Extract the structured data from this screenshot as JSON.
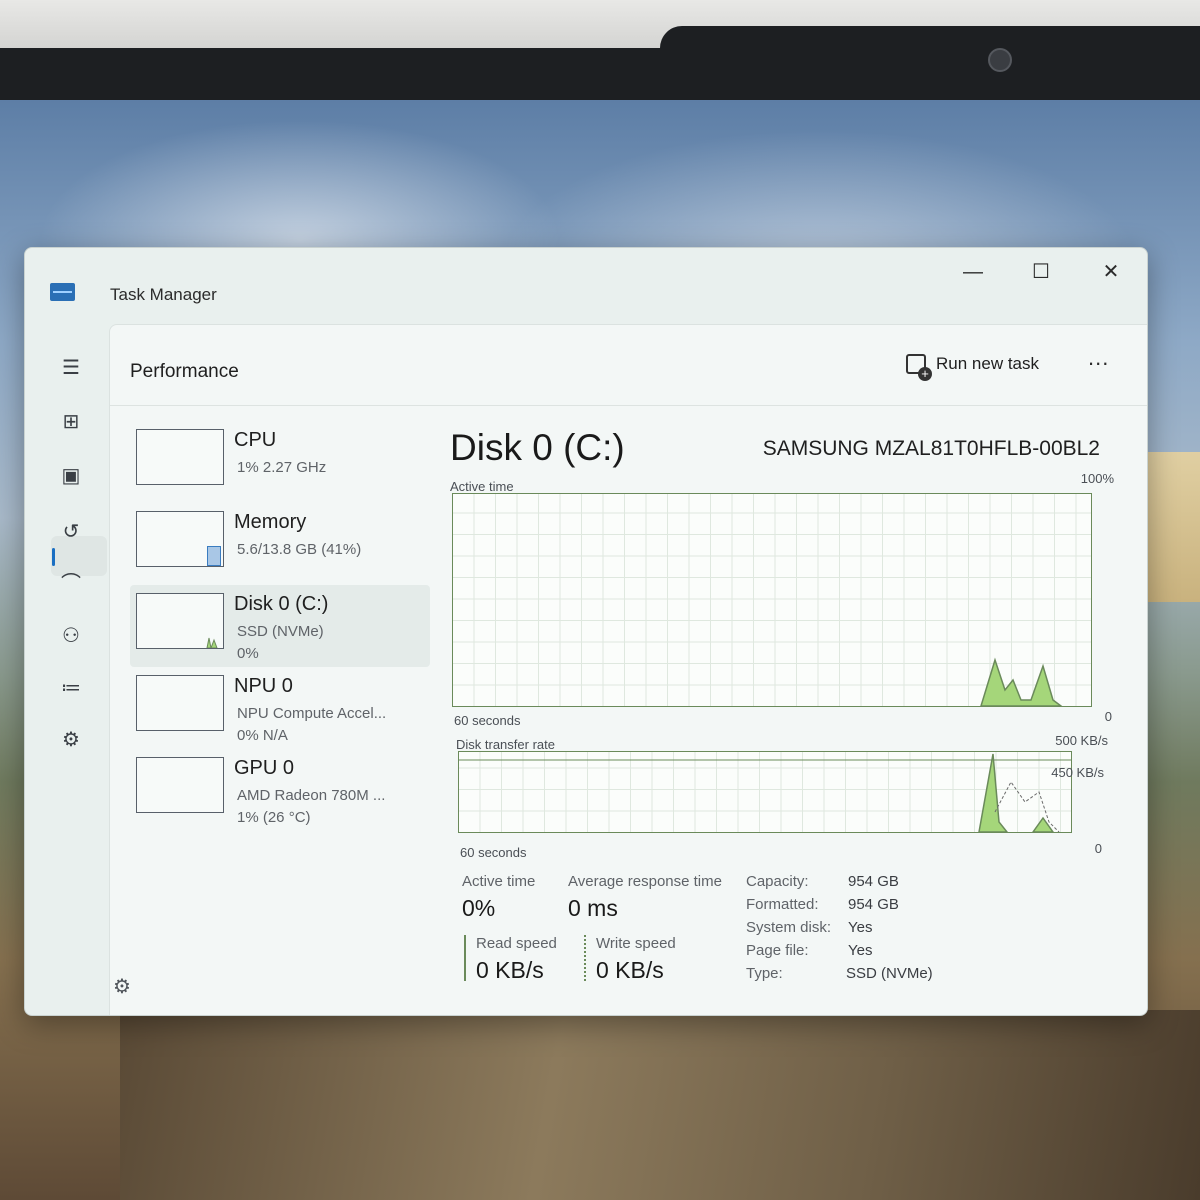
{
  "window": {
    "title": "Task Manager",
    "controls": {
      "minimize": "—",
      "maximize": "☐",
      "close": "✕"
    }
  },
  "nav": {
    "icons": [
      "menu-icon",
      "processes-icon",
      "performance-icon",
      "app-history-icon",
      "startup-apps-icon",
      "users-icon",
      "details-icon",
      "services-icon"
    ],
    "active": "performance-icon"
  },
  "header": {
    "page_title": "Performance",
    "run_task_label": "Run new task",
    "more_label": "..."
  },
  "devices": [
    {
      "name": "CPU",
      "sub1": "1% 2.27 GHz",
      "sub2": ""
    },
    {
      "name": "Memory",
      "sub1": "5.6/13.8 GB (41%)",
      "sub2": ""
    },
    {
      "name": "Disk 0 (C:)",
      "sub1": "SSD (NVMe)",
      "sub2": "0%"
    },
    {
      "name": "NPU 0",
      "sub1": "NPU Compute Accel...",
      "sub2": "0% N/A"
    },
    {
      "name": "GPU 0",
      "sub1": "AMD Radeon 780M ...",
      "sub2": "1% (26 °C)"
    }
  ],
  "detail": {
    "title": "Disk 0 (C:)",
    "model": "SAMSUNG MZAL81T0HFLB-00BL2",
    "active_graph": {
      "label": "Active time",
      "max": "100%",
      "time": "60 seconds",
      "min": "0"
    },
    "transfer_graph": {
      "label": "Disk transfer rate",
      "max": "500 KB/s",
      "line": "450 KB/s",
      "time": "60 seconds",
      "min": "0"
    },
    "stats": {
      "active_time_label": "Active time",
      "active_time": "0%",
      "avg_resp_label": "Average response time",
      "avg_resp": "0 ms",
      "read_label": "Read speed",
      "read": "0 KB/s",
      "write_label": "Write speed",
      "write": "0 KB/s"
    },
    "props": [
      {
        "k": "Capacity:",
        "v": "954 GB"
      },
      {
        "k": "Formatted:",
        "v": "954 GB"
      },
      {
        "k": "System disk:",
        "v": "Yes"
      },
      {
        "k": "Page file:",
        "v": "Yes"
      },
      {
        "k": "Type:",
        "v": "SSD (NVMe)"
      }
    ]
  },
  "colors": {
    "accent": "#1a6fc2",
    "graph_fill": "#a5d67a",
    "graph_line": "#6a8a5a"
  }
}
